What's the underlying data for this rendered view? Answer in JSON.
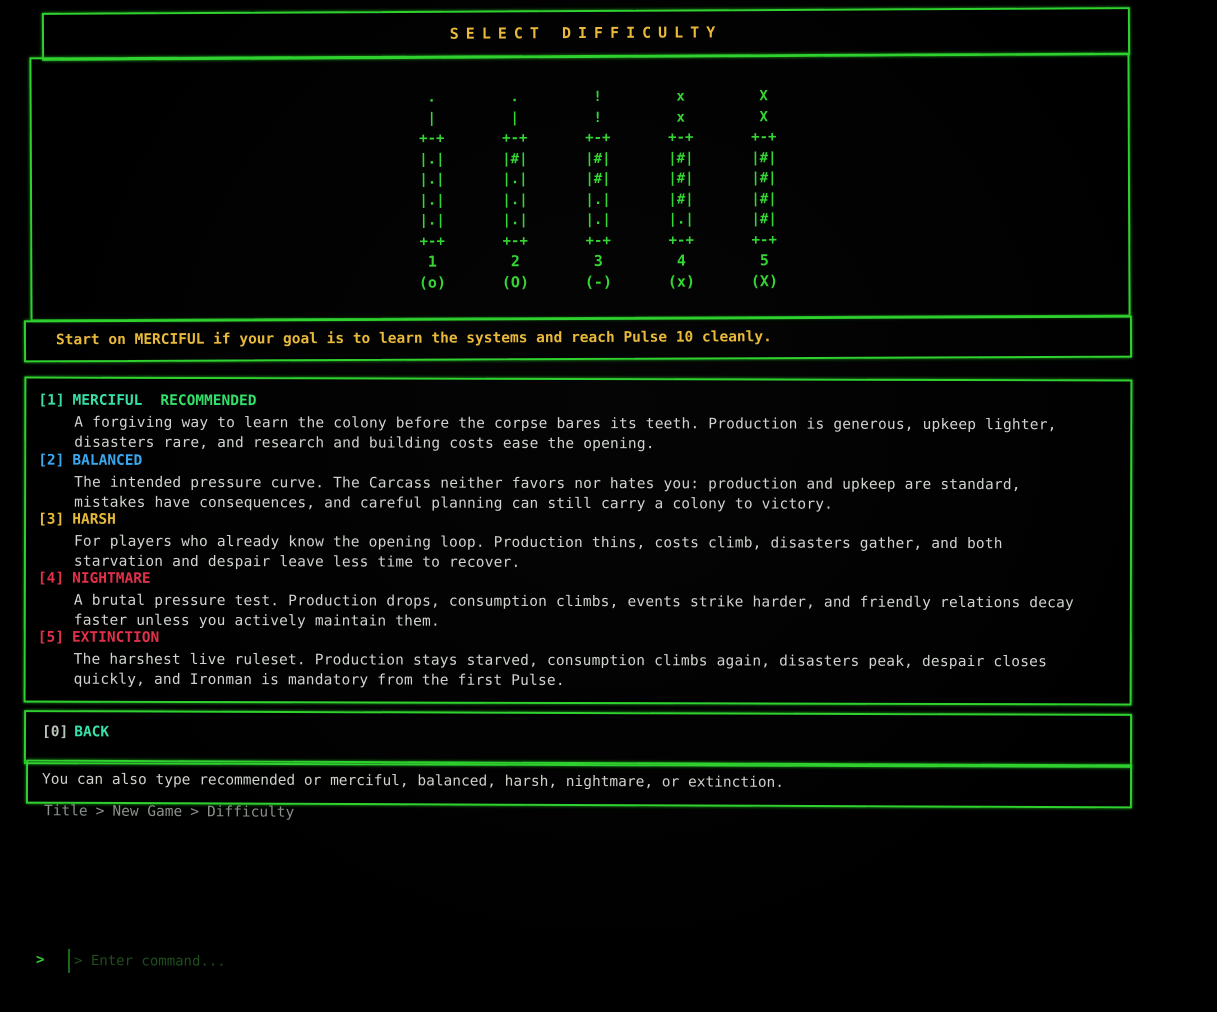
{
  "title": "SELECT DIFFICULTY",
  "gauges": [
    {
      "lines": [
        ".",
        "|",
        "+-+",
        "|.|",
        "|.|",
        "|.|",
        "|.|",
        "+-+"
      ],
      "number": "1",
      "symbol": "(o)"
    },
    {
      "lines": [
        ".",
        "|",
        "+-+",
        "|#|",
        "|.|",
        "|.|",
        "|.|",
        "+-+"
      ],
      "number": "2",
      "symbol": "(O)"
    },
    {
      "lines": [
        "!",
        "!",
        "+-+",
        "|#|",
        "|#|",
        "|.|",
        "|.|",
        "+-+"
      ],
      "number": "3",
      "symbol": "(-)"
    },
    {
      "lines": [
        "x",
        "x",
        "+-+",
        "|#|",
        "|#|",
        "|#|",
        "|.|",
        "+-+"
      ],
      "number": "4",
      "symbol": "(x)"
    },
    {
      "lines": [
        "X",
        "X",
        "+-+",
        "|#|",
        "|#|",
        "|#|",
        "|#|",
        "+-+"
      ],
      "number": "5",
      "symbol": "(X)"
    }
  ],
  "tip": "Start on MERCIFUL if your goal is to learn the systems and reach Pulse 10 cleanly.",
  "options": [
    {
      "key": "[1]",
      "name": "MERCIFUL",
      "badge": "RECOMMENDED",
      "description": "A forgiving way to learn the colony before the corpse bares its teeth. Production is generous, upkeep lighter,\ndisasters rare, and research and building costs ease the opening.",
      "color": "#36e0a8"
    },
    {
      "key": "[2]",
      "name": "BALANCED",
      "badge": "",
      "description": "The intended pressure curve. The Carcass neither favors nor hates you: production and upkeep are standard,\nmistakes have consequences, and careful planning can still carry a colony to victory.",
      "color": "#3aa8f0"
    },
    {
      "key": "[3]",
      "name": "HARSH",
      "badge": "",
      "description": "For players who already know the opening loop. Production thins, costs climb, disasters gather, and both\nstarvation and despair leave less time to recover.",
      "color": "#e8b93a"
    },
    {
      "key": "[4]",
      "name": "NIGHTMARE",
      "badge": "",
      "description": "A brutal pressure test. Production drops, consumption climbs, events strike harder, and friendly relations decay\nfaster unless you actively maintain them.",
      "color": "#e0304a"
    },
    {
      "key": "[5]",
      "name": "EXTINCTION",
      "badge": "",
      "description": "The harshest live ruleset. Production stays starved, consumption climbs again, disasters peak, despair closes\nquickly, and Ironman is mandatory from the first Pulse.",
      "color": "#e0304a"
    }
  ],
  "back": {
    "key": "[0]",
    "label": "BACK"
  },
  "hint": "You can also type recommended or merciful, balanced, harsh, nightmare, or extinction.",
  "breadcrumb": [
    "Title",
    "New Game",
    "Difficulty"
  ],
  "breadcrumb_separator": ">",
  "prompt": ">",
  "command": {
    "placeholder": "> Enter command...",
    "value": ""
  },
  "colors": {
    "border": "#2fd12f",
    "accent_gold": "#e8b93a",
    "merciful": "#36e0a8",
    "balanced": "#3aa8f0",
    "harsh": "#e8b93a",
    "nightmare": "#e0304a",
    "extinction": "#e0304a"
  }
}
